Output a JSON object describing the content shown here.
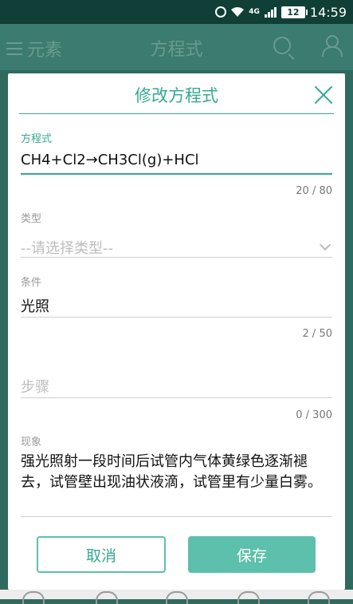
{
  "status_bar": {
    "network": "4G",
    "battery": "12",
    "time": "14:59"
  },
  "app_bar": {
    "menu_label": "元素",
    "title": "方程式"
  },
  "dialog": {
    "title": "修改方程式",
    "equation": {
      "label": "方程式",
      "value": "CH4+Cl2→CH3Cl(g)+HCl",
      "counter": "20 / 80"
    },
    "type": {
      "label": "类型",
      "value": "--请选择类型--"
    },
    "condition": {
      "label": "条件",
      "value": "光照",
      "counter": "2 / 50"
    },
    "steps": {
      "placeholder": "步骤",
      "counter": "0 / 300"
    },
    "phenomenon": {
      "label": "现象",
      "value": "强光照射一段时间后试管内气体黄绿色逐渐褪去，试管壁出现油状液滴，试管里有少量白雾。"
    },
    "cancel_label": "取消",
    "save_label": "保存"
  },
  "colors": {
    "accent": "#36a992",
    "button": "#5cc0ac",
    "status_bar": "#0f3f36",
    "app_bar": "#3c7b6f"
  }
}
